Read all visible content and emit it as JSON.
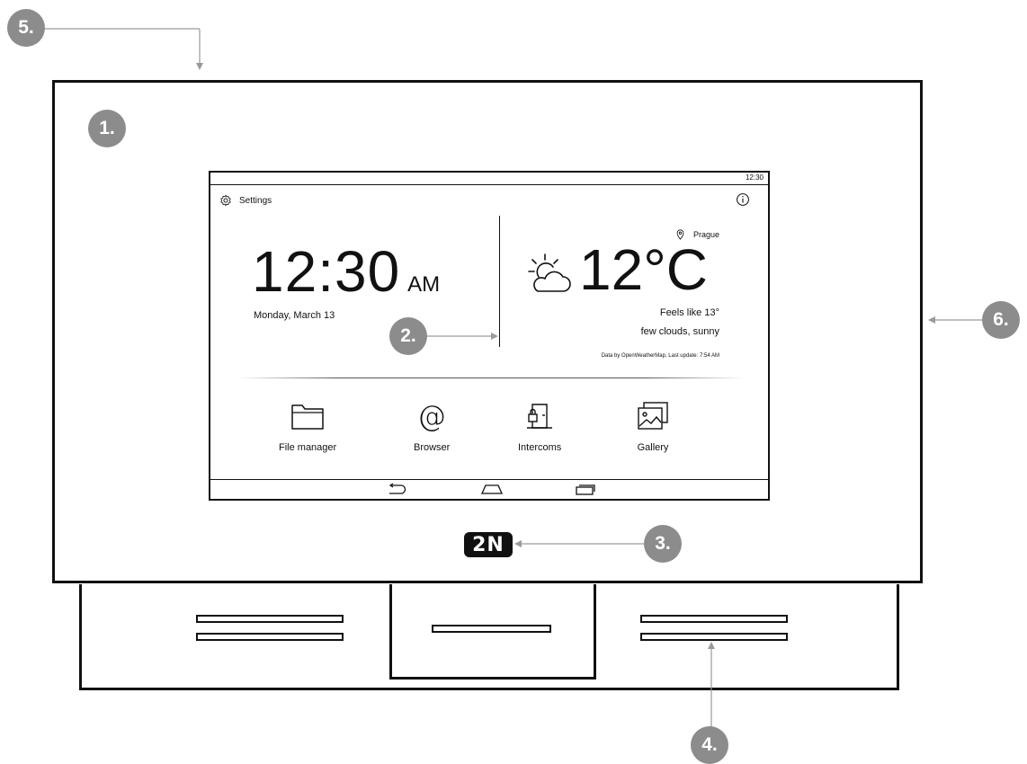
{
  "callouts": [
    "1.",
    "2.",
    "3.",
    "4.",
    "5.",
    "6."
  ],
  "screen": {
    "status_time": "12:30",
    "settings_label": "Settings",
    "clock_time": "12:30",
    "clock_ampm": "AM",
    "date": "Monday, March 13",
    "location": "Prague",
    "temperature": "12°C",
    "feels_like": "Feels like 13°",
    "weather_desc": "few clouds, sunny",
    "data_source": "Data by OpenWeatherMap, Last update: 7:54 AM",
    "apps": [
      {
        "label": "File manager",
        "icon": "folder-icon"
      },
      {
        "label": "Browser",
        "icon": "at-icon"
      },
      {
        "label": "Intercoms",
        "icon": "door-lock-icon"
      },
      {
        "label": "Gallery",
        "icon": "gallery-icon"
      }
    ],
    "nav_icons": [
      "back-icon",
      "home-icon",
      "recents-icon"
    ]
  },
  "logo_text": "2N",
  "colors": {
    "badge": "#8c8c8c",
    "lines": "#111111",
    "arrows": "#9a9a9a"
  }
}
